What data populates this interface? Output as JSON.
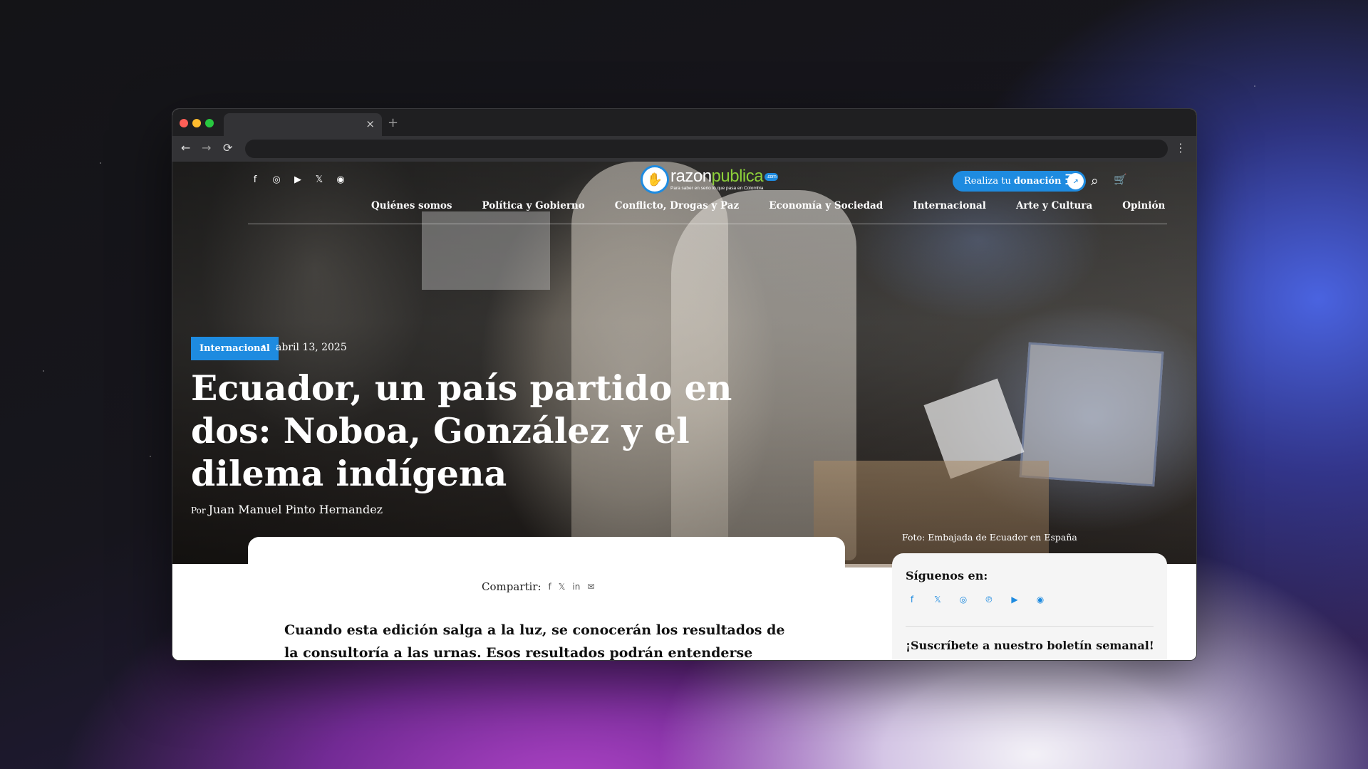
{
  "browser": {
    "tab_close": "×",
    "new_tab": "+",
    "back": "←",
    "forward": "→",
    "reload": "⟳",
    "menu": "⋮"
  },
  "site": {
    "social_top": [
      "f",
      "◎",
      "▶",
      "𝕏",
      "◉"
    ],
    "logo": {
      "part1": "razon",
      "part2": "publica",
      "com": ".com",
      "tagline": "Para saber en serio lo que pasa en Colombia"
    },
    "donate": {
      "label": "Realiza tu",
      "bold": "donación",
      "arrow": "↗"
    },
    "icons": {
      "menu": "☰",
      "search": "⌕",
      "cart": "🛒"
    },
    "nav": [
      "Quiénes somos",
      "Política y Gobierno",
      "Conflicto, Drogas y Paz",
      "Economía y Sociedad",
      "Internacional",
      "Arte y Cultura",
      "Opinión"
    ]
  },
  "article": {
    "category": "Internacional",
    "date": "abril 13, 2025",
    "title": "Ecuador, un país partido en dos: Noboa, González y el dilema indígena",
    "by": "Por",
    "author": "Juan Manuel Pinto Hernandez",
    "photo_credit": "Foto: Embajada de Ecuador en España",
    "share_label": "Compartir:",
    "share_icons": [
      "f",
      "𝕏",
      "in",
      "✉"
    ],
    "intro": "Cuando esta edición salga a la luz, se conocerán los resultados de la consultoría a las urnas. Esos resultados podrán entenderse mejor con el"
  },
  "sidebar": {
    "follow_title": "Síguenos en:",
    "follow_icons": [
      "f",
      "𝕏",
      "◎",
      "℗",
      "▶",
      "◉"
    ],
    "newsletter_title": "¡Suscríbete a nuestro boletín semanal!"
  },
  "colors": {
    "accent": "#1e8be0",
    "logo_green": "#8ccf3a"
  }
}
